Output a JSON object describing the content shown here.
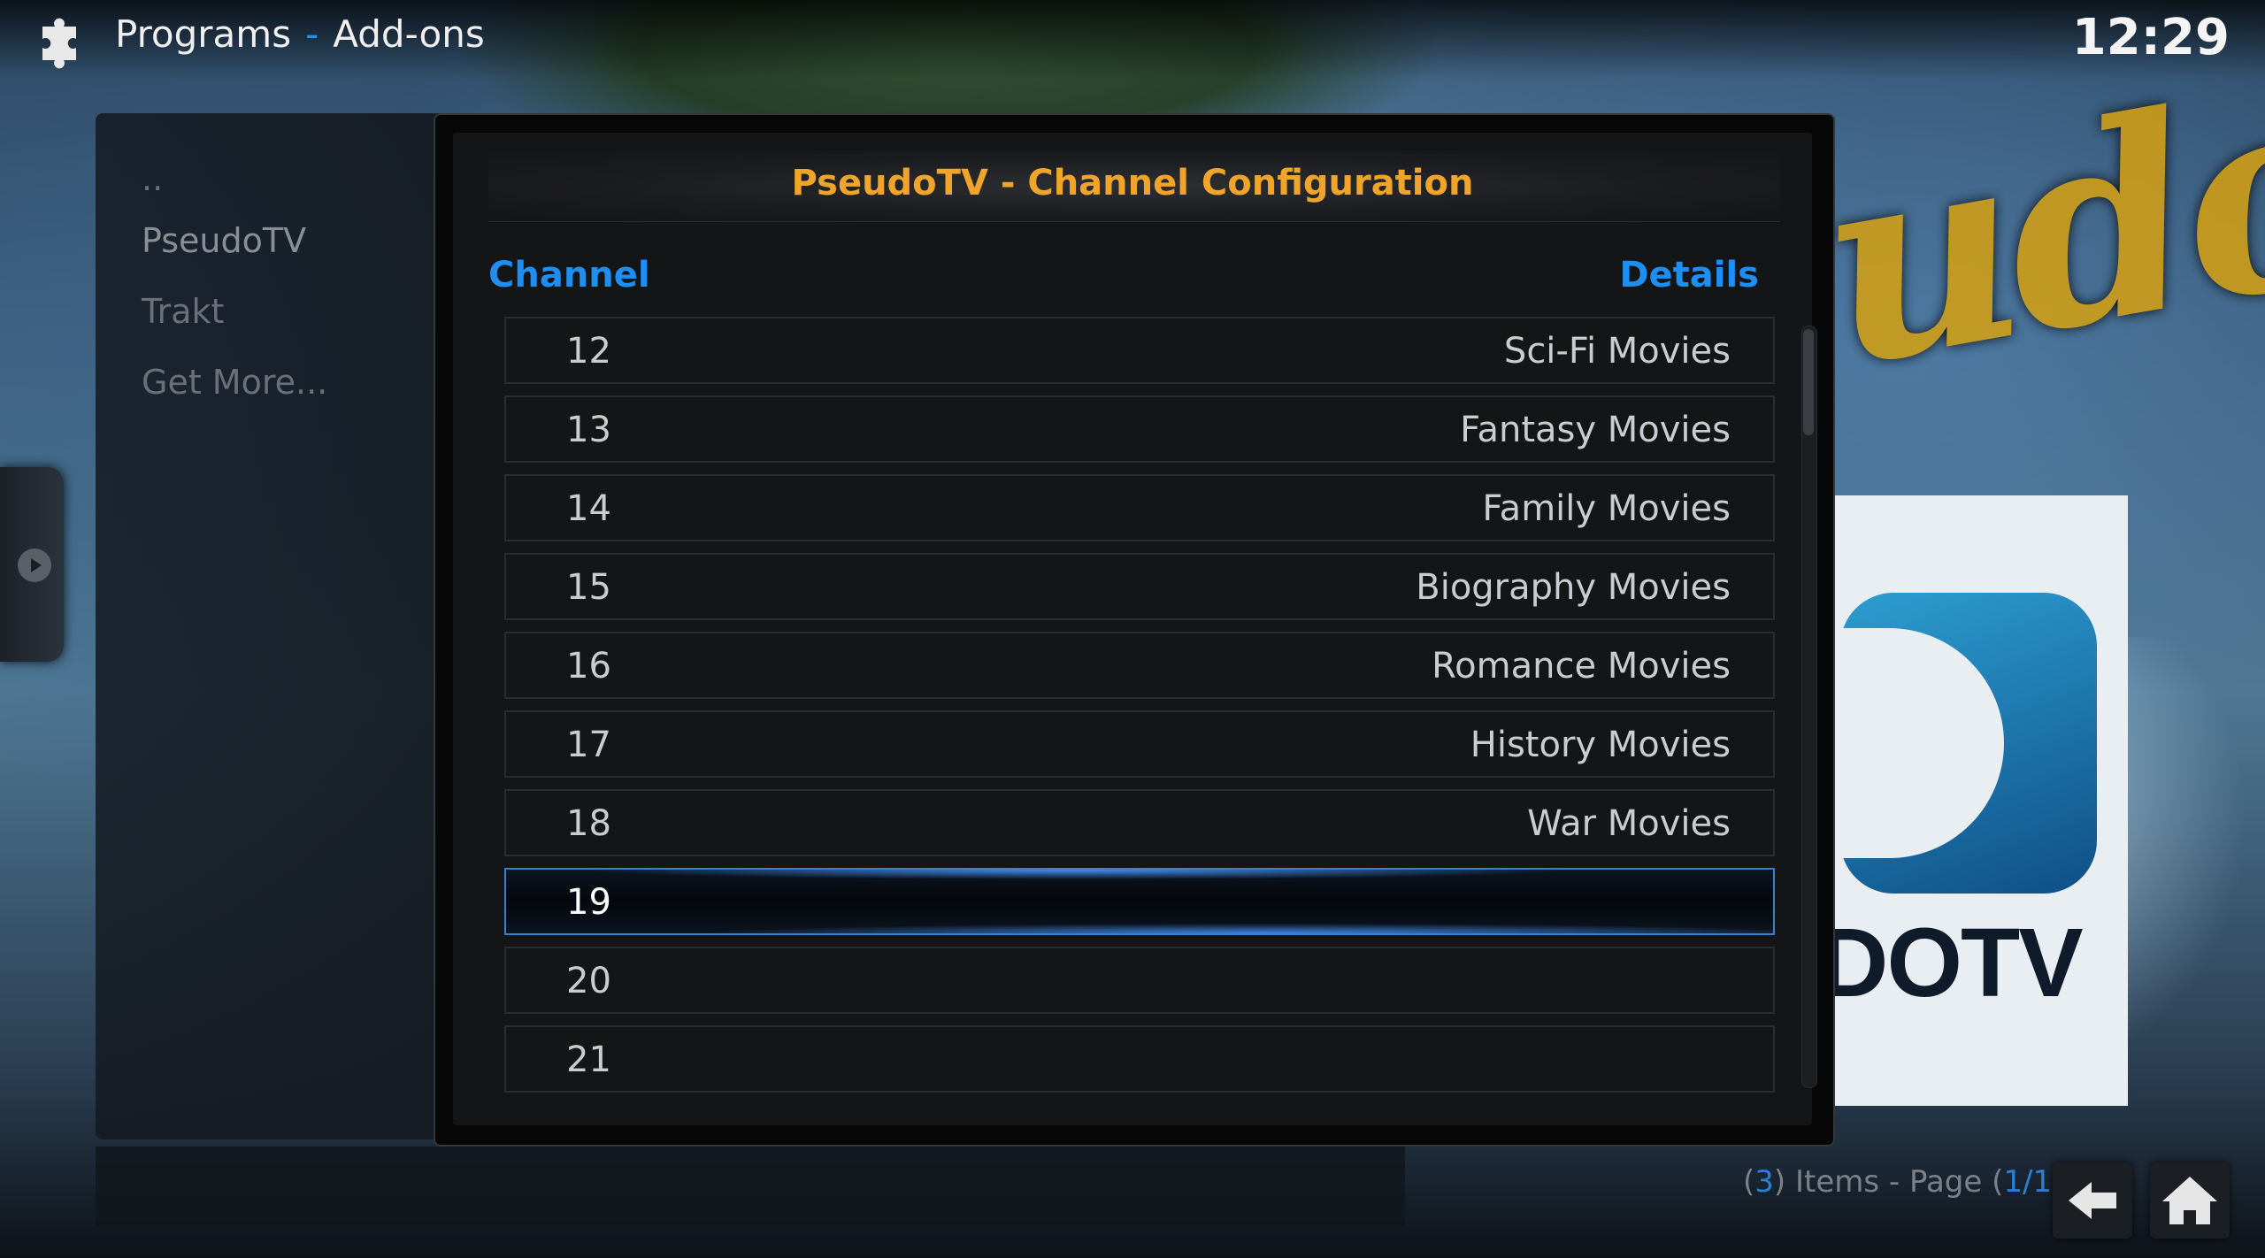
{
  "header": {
    "section": "Programs",
    "separator": "-",
    "subsection": "Add-ons",
    "clock": "12:29"
  },
  "sidebar": {
    "items": [
      {
        "label": ".."
      },
      {
        "label": "PseudoTV"
      },
      {
        "label": "Trakt"
      },
      {
        "label": "Get More..."
      }
    ]
  },
  "dialog": {
    "title": "PseudoTV - Channel Configuration",
    "column_channel": "Channel",
    "column_details": "Details",
    "rows": [
      {
        "channel": "12",
        "details": "Sci-Fi Movies"
      },
      {
        "channel": "13",
        "details": "Fantasy Movies"
      },
      {
        "channel": "14",
        "details": "Family Movies"
      },
      {
        "channel": "15",
        "details": "Biography Movies"
      },
      {
        "channel": "16",
        "details": "Romance Movies"
      },
      {
        "channel": "17",
        "details": "History Movies"
      },
      {
        "channel": "18",
        "details": "War Movies"
      },
      {
        "channel": "19",
        "details": ""
      },
      {
        "channel": "20",
        "details": ""
      },
      {
        "channel": "21",
        "details": ""
      }
    ],
    "focused_channel": "19"
  },
  "footer": {
    "open_paren": "(",
    "item_count": "3",
    "items_page_label": ") Items - Page (",
    "page": "1/1",
    "close_paren": ")"
  },
  "background": {
    "poster_text": "DOTV"
  },
  "colors": {
    "accent_blue": "#1e8ef0",
    "title_orange": "#f0a52a",
    "focus_border": "#3b7fd0"
  },
  "icons": {
    "header": "puzzle-piece-icon",
    "sidebar_toggle": "chevron-right-icon",
    "back": "back-arrow-icon",
    "home": "home-icon"
  }
}
